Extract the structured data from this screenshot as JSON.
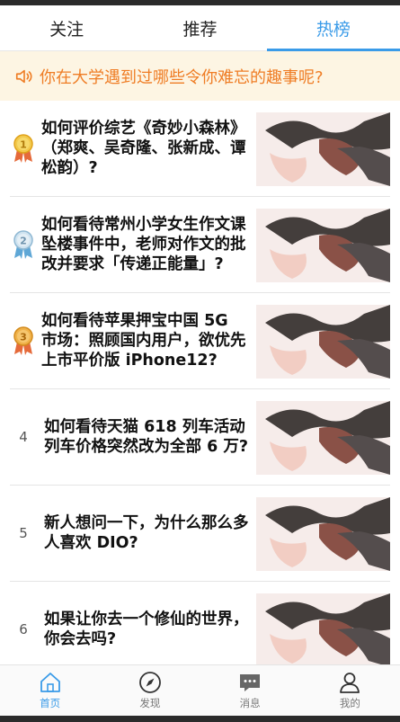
{
  "tabs": [
    {
      "label": "关注",
      "active": false
    },
    {
      "label": "推荐",
      "active": false
    },
    {
      "label": "热榜",
      "active": true
    }
  ],
  "notice": {
    "icon": "speaker-icon",
    "text": "你在大学遇到过哪些令你难忘的趣事呢?"
  },
  "items": [
    {
      "rank": "1",
      "badge": "gold-medal-icon",
      "title": "如何评价综艺《奇妙小森林》（郑爽、吴奇隆、张新成、谭松韵）?"
    },
    {
      "rank": "2",
      "badge": "silver-medal-icon",
      "title": "如何看待常州小学女生作文课坠楼事件中，老师对作文的批改并要求「传递正能量」?"
    },
    {
      "rank": "3",
      "badge": "bronze-medal-icon",
      "title": "如何看待苹果押宝中国 5G 市场：照顾国内用户，欲优先上市平价版 iPhone12?"
    },
    {
      "rank": "4",
      "title": "如何看待天猫 618 列车活动列车价格突然改为全部 6 万?"
    },
    {
      "rank": "5",
      "title": "新人想问一下，为什么那么多人喜欢 DIO?"
    },
    {
      "rank": "6",
      "title": "如果让你去一个修仙的世界，你会去吗?"
    }
  ],
  "nav": [
    {
      "label": "首页",
      "icon": "home-icon",
      "active": true
    },
    {
      "label": "发现",
      "icon": "compass-icon",
      "active": false
    },
    {
      "label": "消息",
      "icon": "message-icon",
      "active": false
    },
    {
      "label": "我的",
      "icon": "user-icon",
      "active": false
    }
  ],
  "colors": {
    "accent": "#3a9be8",
    "notice_text": "#ef7d25",
    "notice_bg": "#fdf5e3",
    "gold": "#e9b224",
    "silver": "#9cc4dd",
    "bronze": "#e7a437"
  }
}
